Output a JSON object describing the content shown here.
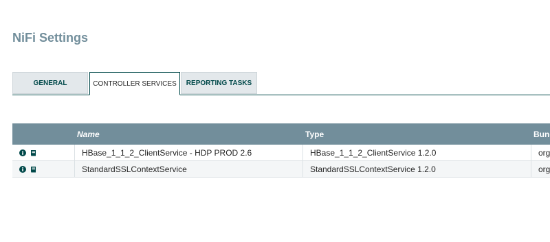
{
  "page": {
    "title": "NiFi Settings"
  },
  "tabs": [
    {
      "label": "GENERAL",
      "selected": false
    },
    {
      "label": "CONTROLLER SERVICES",
      "selected": true
    },
    {
      "label": "REPORTING TASKS",
      "selected": false
    }
  ],
  "table": {
    "columns": {
      "name": "Name",
      "type": "Type",
      "bundle": "Bund"
    },
    "rows": [
      {
        "icons": [
          "info-icon",
          "book-icon"
        ],
        "name": "HBase_1_1_2_ClientService - HDP PROD 2.6",
        "type": "HBase_1_1_2_ClientService 1.2.0",
        "bundle": "org"
      },
      {
        "icons": [
          "info-icon",
          "book-icon"
        ],
        "name": "StandardSSLContextService",
        "type": "StandardSSLContextService 1.2.0",
        "bundle": "org"
      }
    ]
  },
  "colors": {
    "title": "#728e9b",
    "header_bg": "#728e9b",
    "accent": "#004849"
  }
}
